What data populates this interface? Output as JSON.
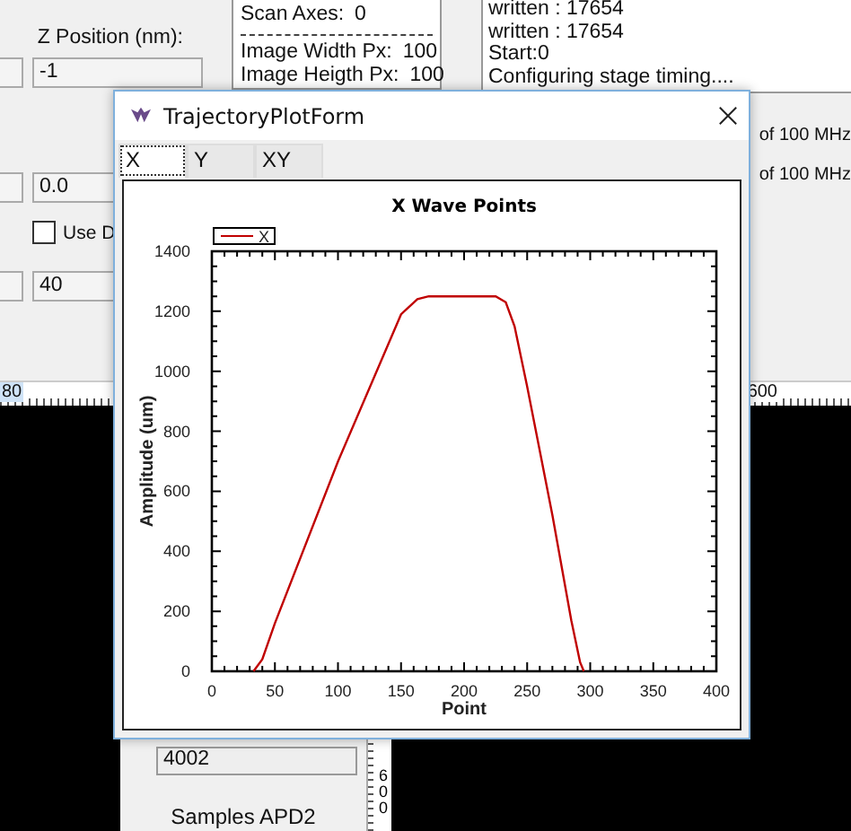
{
  "background_window": {
    "z_position_label": "Z Position (nm):",
    "z_position_value": "-1",
    "offset_value": "0.0",
    "use_checkbox": {
      "label": "Use D",
      "checked": false
    },
    "count_value": "40",
    "info_lines": [
      {
        "label": "Scan Axes:",
        "value": "0"
      },
      {
        "label": "Image Width Px:",
        "value": "100"
      },
      {
        "label": "Image Heigth Px:",
        "value": "100"
      }
    ],
    "log_lines": [
      "written : 17654",
      "written : 17654",
      "Start:0",
      "Configuring stage timing...."
    ],
    "rate_labels": [
      "of 100 MHz",
      "of 100 MHz"
    ],
    "ruler_labels": [
      "80",
      "600"
    ],
    "sample_value": "4002",
    "samples_label": "Samples APD2",
    "vertical_ruler_label": "600"
  },
  "dialog": {
    "title": "TrajectoryPlotForm",
    "tabs": [
      {
        "label": "X",
        "selected": true
      },
      {
        "label": "Y",
        "selected": false
      },
      {
        "label": "XY",
        "selected": false
      }
    ],
    "chart_data": {
      "type": "line",
      "title": "X Wave Points",
      "xlabel": "Point",
      "ylabel": "Amplitude (um)",
      "x": [
        33,
        40,
        50,
        100,
        150,
        163,
        172,
        225,
        233,
        240,
        250,
        270,
        285,
        292,
        295
      ],
      "series": [
        {
          "name": "X",
          "color": "#c00000",
          "values": [
            0,
            40,
            160,
            700,
            1190,
            1240,
            1250,
            1250,
            1230,
            1150,
            950,
            520,
            170,
            30,
            0
          ]
        }
      ],
      "xlim": [
        0,
        400
      ],
      "ylim": [
        0,
        1400
      ],
      "xticks": [
        0,
        50,
        100,
        150,
        200,
        250,
        300,
        350,
        400
      ],
      "yticks": [
        0,
        200,
        400,
        600,
        800,
        1000,
        1200,
        1400
      ]
    }
  }
}
